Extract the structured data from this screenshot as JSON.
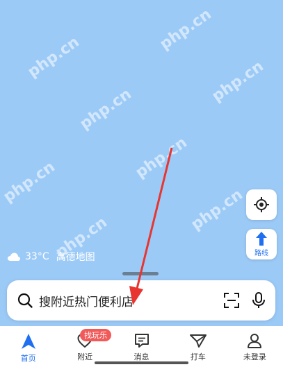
{
  "watermark": "php.cn",
  "map": {
    "weather": {
      "temperature": "33°C",
      "icon": "cloud-icon"
    },
    "brand": "高德地图",
    "route_label": "路线"
  },
  "search": {
    "placeholder": "搜附近热门便利店"
  },
  "tabs": [
    {
      "label": "首页",
      "icon": "navigation-arrow-icon",
      "active": true
    },
    {
      "label": "附近",
      "icon": "heart-location-icon",
      "badge": "找玩乐"
    },
    {
      "label": "消息",
      "icon": "message-icon"
    },
    {
      "label": "打车",
      "icon": "taxi-icon"
    },
    {
      "label": "未登录",
      "icon": "user-icon"
    }
  ],
  "colors": {
    "map_background": "#9ccaf7",
    "accent": "#1f6ff0",
    "badge": "#f25a5a",
    "annotation_arrow": "#e8352f"
  }
}
